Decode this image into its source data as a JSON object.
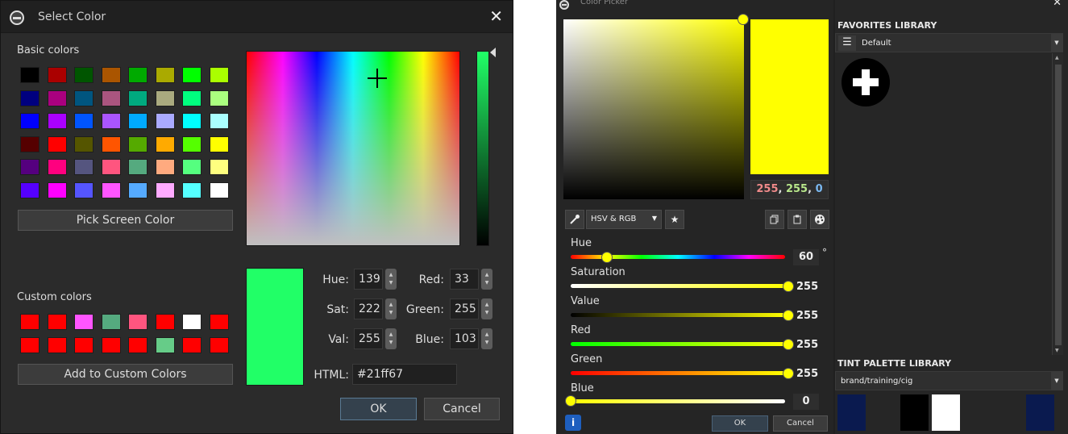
{
  "left_dialog": {
    "title": "Select Color",
    "basic_colors_label": "Basic colors",
    "custom_colors_label": "Custom colors",
    "pick_screen_label": "Pick Screen Color",
    "add_custom_label": "Add to Custom Colors",
    "basic_swatches": [
      "#000000",
      "#aa0000",
      "#005500",
      "#aa5500",
      "#00aa00",
      "#aaaa00",
      "#00ff00",
      "#aaff00",
      "#00007f",
      "#aa007f",
      "#00557f",
      "#aa557f",
      "#00aa7f",
      "#aaaa7f",
      "#00ff7f",
      "#aaff7f",
      "#0000ff",
      "#aa00ff",
      "#0055ff",
      "#aa55ff",
      "#00aaff",
      "#aaaaff",
      "#00ffff",
      "#aaffff",
      "#550000",
      "#ff0000",
      "#555500",
      "#ff5500",
      "#55aa00",
      "#ffaa00",
      "#55ff00",
      "#ffff00",
      "#55007f",
      "#ff007f",
      "#55557f",
      "#ff557f",
      "#55aa7f",
      "#ffaa7f",
      "#55ff7f",
      "#ffff7f",
      "#5500ff",
      "#ff00ff",
      "#5555ff",
      "#ff55ff",
      "#55aaff",
      "#ffaaff",
      "#55ffff",
      "#ffffff"
    ],
    "custom_swatches": [
      "#ff0000",
      "#ff0000",
      "#ff55ff",
      "#55aa7f",
      "#ff557f",
      "#ff0000",
      "#ffffff",
      "#ff0000",
      "#ff0000",
      "#ff0000",
      "#ff0000",
      "#ff0000",
      "#ff0000",
      "#66cc88",
      "#ff0000",
      "#ff0000"
    ],
    "preview_color": "#21ff67",
    "fields": {
      "hue_label": "Hue:",
      "hue": "139",
      "sat_label": "Sat:",
      "sat": "222",
      "val_label": "Val:",
      "val": "255",
      "red_label": "Red:",
      "red": "33",
      "green_label": "Green:",
      "green": "255",
      "blue_label": "Blue:",
      "blue": "103",
      "html_label": "HTML:",
      "html": "#21ff67"
    },
    "ok_label": "OK",
    "cancel_label": "Cancel"
  },
  "right_dialog": {
    "title": "Color Picker",
    "current_color": "#ffff00",
    "rgb_readout": {
      "r": "255",
      "sep1": ", ",
      "g": "255",
      "sep2": ", ",
      "b": "0"
    },
    "mode_label": "HSV & RGB",
    "sliders": {
      "hue_label": "Hue",
      "hue_value": "60",
      "hue_unit": "°",
      "hue_fraction": 0.167,
      "saturation_label": "Saturation",
      "saturation_value": "255",
      "saturation_fraction": 1.0,
      "value_label": "Value",
      "value_value": "255",
      "value_fraction": 1.0,
      "red_label": "Red",
      "red_value": "255",
      "red_fraction": 1.0,
      "green_label": "Green",
      "green_value": "255",
      "green_fraction": 1.0,
      "blue_label": "Blue",
      "blue_value": "0",
      "blue_fraction": 0.0
    },
    "ok_label": "OK",
    "cancel_label": "Cancel",
    "favorites_header": "FAVORITES LIBRARY",
    "favorites_dropdown": "Default",
    "tint_header": "TINT PALETTE LIBRARY",
    "tint_dropdown": "brand/training/cig",
    "tint_swatches": [
      "#0a1a4f",
      "#262626",
      "#000000",
      "#ffffff",
      "#262626",
      "#262626",
      "#0a1a4f"
    ]
  }
}
